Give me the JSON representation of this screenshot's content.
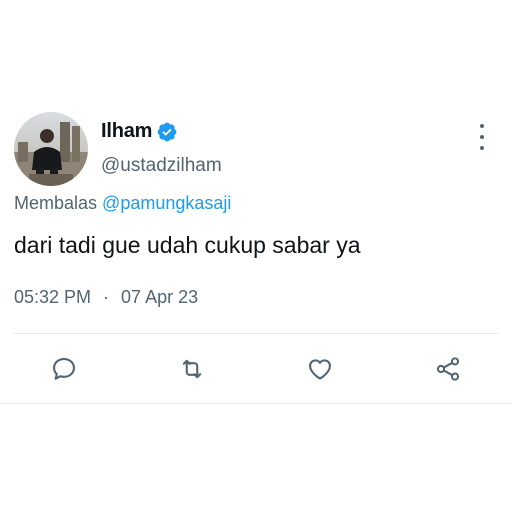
{
  "tweet": {
    "display_name": "Ilham",
    "verified_icon": "verified-badge-icon",
    "handle": "@ustadzilham",
    "reply_prefix": "Membalas",
    "reply_mention": "@pamungkasaji",
    "text": "dari tadi gue udah cukup sabar ya",
    "time": "05:32 PM",
    "separator": "·",
    "date": "07 Apr 23"
  },
  "actions": [
    {
      "name": "reply",
      "icon": "comment-icon"
    },
    {
      "name": "retweet",
      "icon": "retweet-icon"
    },
    {
      "name": "like",
      "icon": "heart-icon"
    },
    {
      "name": "share",
      "icon": "share-icon"
    }
  ],
  "colors": {
    "text_primary": "#0f1419",
    "text_secondary": "#536471",
    "accent": "#1d9bf0",
    "divider": "#e6e9ea"
  }
}
